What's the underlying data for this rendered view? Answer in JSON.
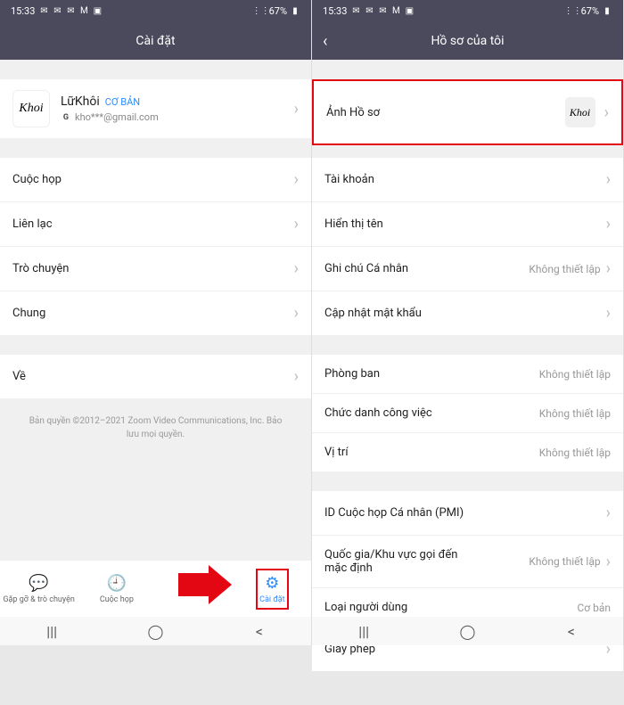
{
  "status": {
    "time": "15:33",
    "battery": "67%",
    "signal_icons": [
      "messenger",
      "chat",
      "sms",
      "mail",
      "m",
      "pic"
    ]
  },
  "left": {
    "header_title": "Cài đặt",
    "profile": {
      "avatar_text": "Khoi",
      "name": "LữKhôi",
      "tag": "CƠ BẢN",
      "email": "kho***@gmail.com"
    },
    "items": [
      {
        "label": "Cuộc họp"
      },
      {
        "label": "Liên lạc"
      },
      {
        "label": "Trò chuyện"
      },
      {
        "label": "Chung"
      }
    ],
    "about": {
      "label": "Về"
    },
    "copyright": "Bản quyền ©2012–2021 Zoom Video Communications, Inc. Bảo lưu mọi quyền.",
    "bottom_nav": [
      {
        "label": "Gặp gỡ & trò chuyện"
      },
      {
        "label": "Cuộc họp"
      },
      {
        "label": ""
      },
      {
        "label": "Cài đặt"
      }
    ]
  },
  "right": {
    "header_title": "Hồ sơ của tôi",
    "photo_row": {
      "label": "Ảnh Hồ sơ",
      "avatar_text": "Khoi"
    },
    "group1": [
      {
        "label": "Tài khoản",
        "value": ""
      },
      {
        "label": "Hiển thị tên",
        "value": ""
      },
      {
        "label": "Ghi chú Cá nhân",
        "value": "Không thiết lập"
      },
      {
        "label": "Cập nhật mật khẩu",
        "value": ""
      }
    ],
    "group2": [
      {
        "label": "Phòng ban",
        "value": "Không thiết lập"
      },
      {
        "label": "Chức danh công việc",
        "value": "Không thiết lập"
      },
      {
        "label": "Vị trí",
        "value": "Không thiết lập"
      }
    ],
    "group3": [
      {
        "label": "ID Cuộc họp Cá nhân (PMI)",
        "value": ""
      },
      {
        "label": "Quốc gia/Khu vực gọi đến mặc định",
        "value": "Không thiết lập"
      },
      {
        "label": "Loại người dùng",
        "value": "Cơ bản"
      },
      {
        "label": "Giấy phép",
        "value": ""
      }
    ]
  }
}
